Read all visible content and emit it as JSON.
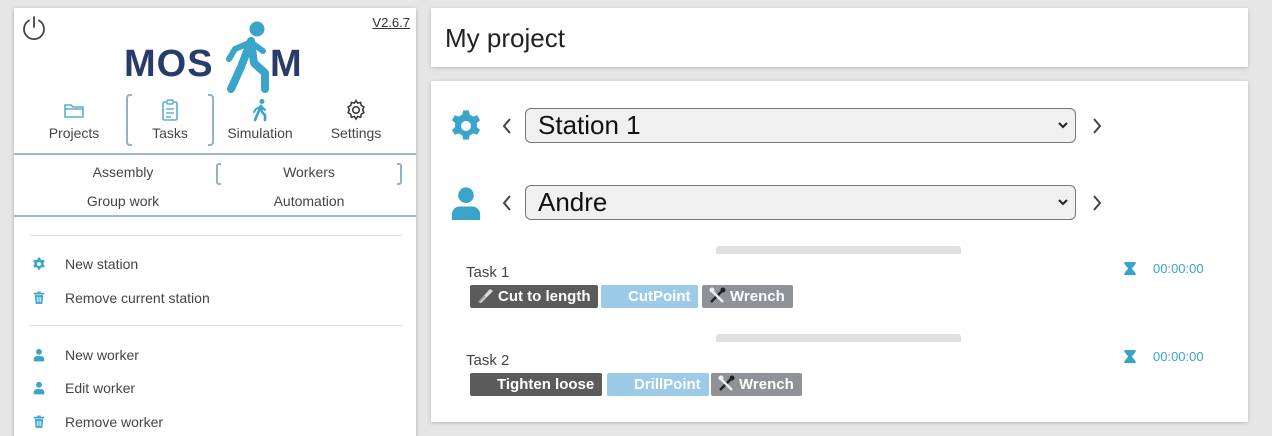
{
  "sidebar": {
    "version": "V2.6.7",
    "logo": {
      "text_left": "MOS",
      "text_right": "M"
    },
    "nav": [
      {
        "label": "Projects",
        "icon": "folder-icon",
        "active": false
      },
      {
        "label": "Tasks",
        "icon": "clipboard-icon",
        "active": true
      },
      {
        "label": "Simulation",
        "icon": "walking-person-icon",
        "active": false
      },
      {
        "label": "Settings",
        "icon": "gear-icon",
        "active": false
      }
    ],
    "subnav": [
      {
        "label": "Assembly",
        "active": false
      },
      {
        "label": "Workers",
        "active": true
      },
      {
        "label": "Group work",
        "active": false
      },
      {
        "label": "Automation",
        "active": false
      }
    ],
    "actions": [
      {
        "label": "New station",
        "icon": "gear-icon"
      },
      {
        "label": "Remove current station",
        "icon": "trash-icon"
      },
      {
        "label": "New worker",
        "icon": "user-icon"
      },
      {
        "label": "Edit worker",
        "icon": "user-icon"
      },
      {
        "label": "Remove worker",
        "icon": "trash-icon"
      }
    ]
  },
  "header": {
    "title": "My project"
  },
  "content": {
    "station": {
      "value": "Station 1",
      "icon": "gear-icon"
    },
    "worker": {
      "value": "Andre",
      "icon": "user-icon"
    },
    "tasks": [
      {
        "name": "Task 1",
        "time": "00:00:00",
        "tags": [
          {
            "label": "Cut to length",
            "icon": "saw-icon"
          },
          {
            "label": "CutPoint",
            "icon": ""
          },
          {
            "label": "Wrench",
            "icon": "tools-icon"
          }
        ]
      },
      {
        "name": "Task 2",
        "time": "00:00:00",
        "tags": [
          {
            "label": "Tighten loose",
            "icon": ""
          },
          {
            "label": "DrillPoint",
            "icon": ""
          },
          {
            "label": "Wrench",
            "icon": "tools-icon"
          }
        ]
      }
    ]
  },
  "colors": {
    "accent": "#3aa4c9",
    "logo_navy": "#283b6b",
    "tag_dark": "#5b5b5b",
    "tag_blue": "#9ccbe8",
    "tag_grey": "#8f9296"
  }
}
